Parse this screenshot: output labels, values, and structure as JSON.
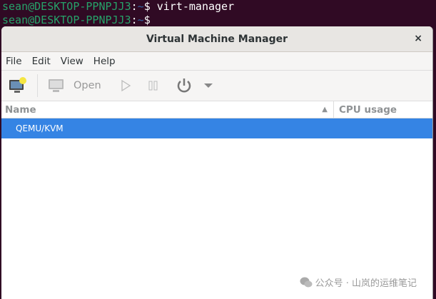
{
  "terminal": {
    "lines": [
      {
        "user": "sean@DESKTOP-PPNPJJ3",
        "sep": ":",
        "path": "~",
        "prompt": "$",
        "cmd": " virt-manager"
      },
      {
        "user": "sean@DESKTOP-PPNPJJ3",
        "sep": ":",
        "path": "~",
        "prompt": "$",
        "cmd": ""
      }
    ]
  },
  "window": {
    "title": "Virtual Machine Manager",
    "close": "×"
  },
  "menu": [
    "File",
    "Edit",
    "View",
    "Help"
  ],
  "toolbar": {
    "open_label": "Open"
  },
  "table": {
    "columns": [
      "Name",
      "CPU usage"
    ],
    "rows": [
      {
        "name": "QEMU/KVM"
      }
    ]
  },
  "watermark": "公众号 · 山岚的运维笔记",
  "colors": {
    "selection": "#3584e4",
    "terminal_bg": "#300a24"
  }
}
